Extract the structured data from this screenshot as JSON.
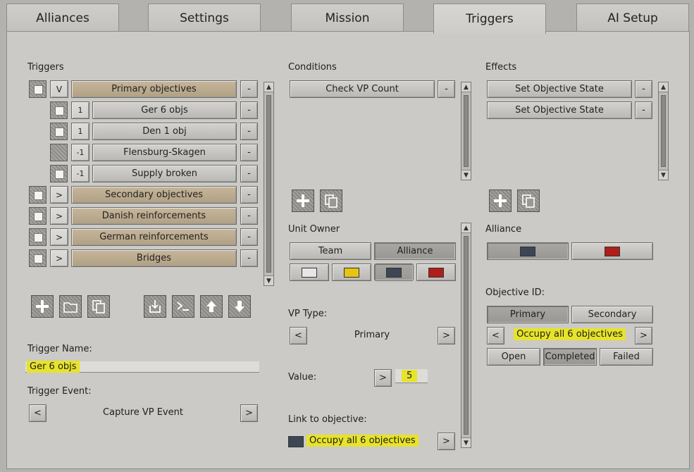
{
  "tabs": [
    {
      "label": "Alliances"
    },
    {
      "label": "Settings"
    },
    {
      "label": "Mission"
    },
    {
      "label": "Triggers"
    },
    {
      "label": "AI Setup"
    }
  ],
  "triggers": {
    "header": "Triggers",
    "rows": [
      {
        "toggle": "V",
        "label": "Primary objectives"
      },
      {
        "num": "1",
        "label": "Ger 6 objs"
      },
      {
        "num": "1",
        "label": "Den 1 obj"
      },
      {
        "num": "-1",
        "label": "Flensburg-Skagen"
      },
      {
        "num": "-1",
        "label": "Supply broken"
      },
      {
        "toggle": ">",
        "label": "Secondary objectives"
      },
      {
        "toggle": ">",
        "label": "Danish reinforcements"
      },
      {
        "toggle": ">",
        "label": "German reinforcements"
      },
      {
        "toggle": ">",
        "label": "Bridges"
      }
    ],
    "remove_label": "-",
    "name_label": "Trigger Name:",
    "name_value": "Ger 6 objs",
    "event_label": "Trigger Event:",
    "event_value": "Capture VP Event",
    "prev": "<",
    "next": ">"
  },
  "conditions": {
    "header": "Conditions",
    "items": [
      {
        "label": "Check VP Count"
      }
    ],
    "remove_label": "-",
    "unit_owner_label": "Unit Owner",
    "team_label": "Team",
    "alliance_label": "Alliance",
    "vp_type_label": "VP Type:",
    "vp_type_value": "Primary",
    "value_label": "Value:",
    "value": "5",
    "link_label": "Link to objective:",
    "link_value": "Occupy all 6 objectives",
    "prev": "<",
    "next": ">"
  },
  "effects": {
    "header": "Effects",
    "items": [
      {
        "label": "Set Objective State"
      },
      {
        "label": "Set Objective State"
      }
    ],
    "remove_label": "-",
    "alliance_label": "Alliance",
    "objective_id_label": "Objective ID:",
    "primary_label": "Primary",
    "secondary_label": "Secondary",
    "objective_value": "Occupy all 6 objectives",
    "open_label": "Open",
    "completed_label": "Completed",
    "failed_label": "Failed",
    "prev": "<",
    "next": ">"
  },
  "colors": {
    "white": "#e6e6e6",
    "yellow": "#e8c410",
    "slate": "#3c4655",
    "red": "#b01e1a",
    "highlight": "#e7e32a",
    "tan": "#bcab8f"
  }
}
